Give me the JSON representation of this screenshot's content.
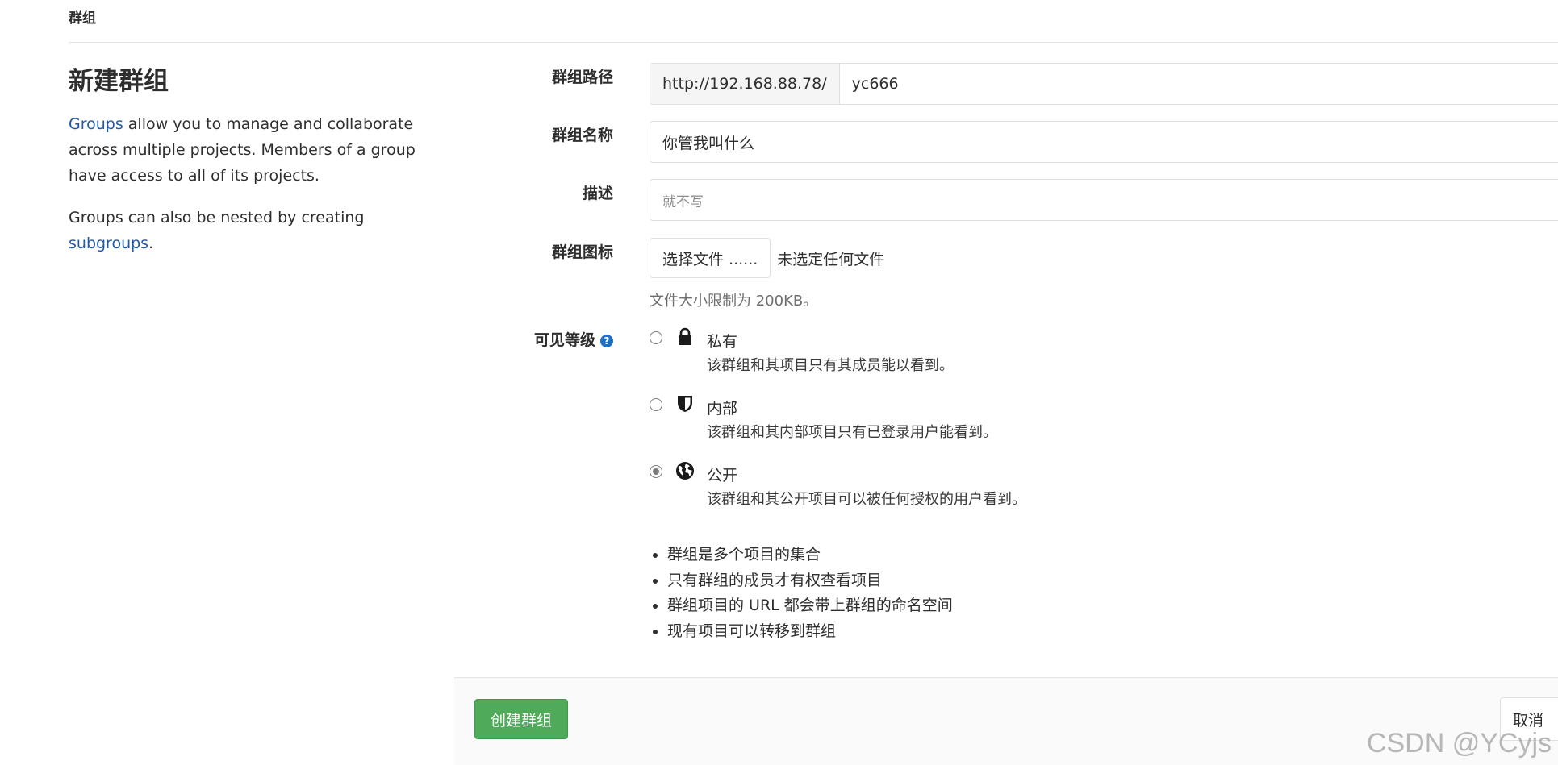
{
  "breadcrumb": "群组",
  "page_title": "新建群组",
  "intro": {
    "p1_link": "Groups",
    "p1_text": " allow you to manage and collaborate across multiple projects. Members of a group have access to all of its projects.",
    "p2_text": "Groups can also be nested by creating ",
    "p2_link": "subgroups",
    "p2_end": "."
  },
  "form": {
    "path": {
      "label": "群组路径",
      "prefix": "http://192.168.88.78/",
      "value": "yc666"
    },
    "name": {
      "label": "群组名称",
      "value": "你管我叫什么"
    },
    "description": {
      "label": "描述",
      "value": "就不写"
    },
    "avatar": {
      "label": "群组图标",
      "button": "选择文件 ......",
      "status": "未选定任何文件",
      "help": "文件大小限制为 200KB。"
    },
    "visibility": {
      "label": "可见等级",
      "help_icon": "question-circle-icon",
      "options": [
        {
          "title": "私有",
          "desc": "该群组和其项目只有其成员能以看到。",
          "icon": "lock-icon",
          "checked": false
        },
        {
          "title": "内部",
          "desc": "该群组和其内部项目只有已登录用户能看到。",
          "icon": "shield-icon",
          "checked": false
        },
        {
          "title": "公开",
          "desc": "该群组和其公开项目可以被任何授权的用户看到。",
          "icon": "globe-icon",
          "checked": true
        }
      ]
    }
  },
  "bullets": [
    "群组是多个项目的集合",
    "只有群组的成员才有权查看项目",
    "群组项目的 URL 都会带上群组的命名空间",
    "现有项目可以转移到群组"
  ],
  "actions": {
    "create": "创建群组",
    "cancel": "取消"
  },
  "watermark": "CSDN @YCyjs",
  "colors": {
    "primary_green": "#4fab5a",
    "link_blue": "#1f5aa8",
    "help_blue": "#1f6fc5"
  }
}
